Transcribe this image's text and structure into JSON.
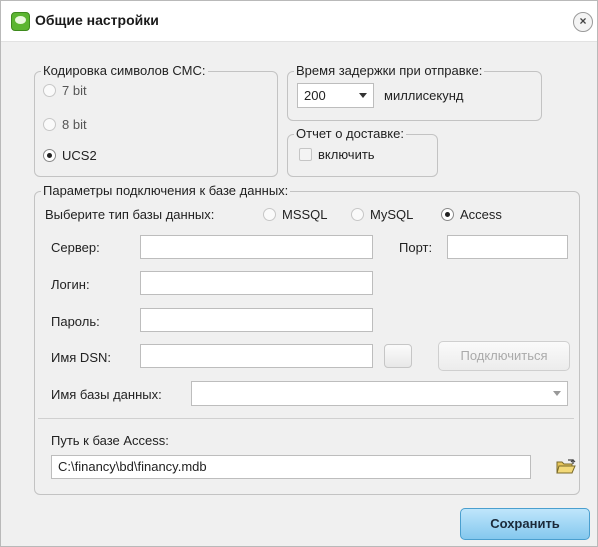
{
  "window": {
    "title": "Общие настройки",
    "close_glyph": "×"
  },
  "encoding": {
    "legend": "Кодировка символов СМС:",
    "options": [
      "7 bit",
      "8 bit",
      "UCS2"
    ],
    "selected": "UCS2"
  },
  "delay": {
    "legend": "Время задержки при отправке:",
    "value": "200",
    "unit": "миллисекунд"
  },
  "delivery": {
    "legend": "Отчет о доставке:",
    "checkbox_label": "включить",
    "checked": false
  },
  "db": {
    "legend": "Параметры подключения к базе данных:",
    "type_label": "Выберите тип базы данных:",
    "types": [
      "MSSQL",
      "MySQL",
      "Access"
    ],
    "selected_type": "Access",
    "server_label": "Сервер:",
    "server_value": "",
    "port_label": "Порт:",
    "port_value": "",
    "login_label": "Логин:",
    "login_value": "",
    "password_label": "Пароль:",
    "password_value": "",
    "dsn_label": "Имя DSN:",
    "dsn_value": "",
    "connect_button": "Подключиться",
    "dbname_label": "Имя базы данных:",
    "dbname_value": "",
    "access_path_label": "Путь к базе Access:",
    "access_path_value": "C:\\financy\\bd\\financy.mdb"
  },
  "buttons": {
    "save": "Сохранить"
  },
  "icons": {
    "app": "app-icon",
    "close": "close-icon",
    "folder": "folder-open-icon"
  }
}
